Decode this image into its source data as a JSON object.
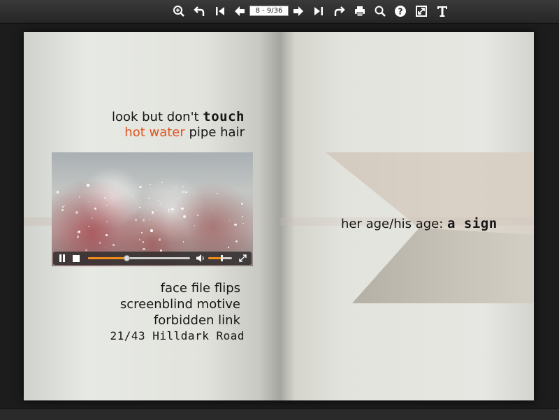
{
  "toolbar": {
    "page_indicator": "8 - 9/36",
    "buttons": [
      {
        "name": "zoom-in-icon"
      },
      {
        "name": "undo-arrow-icon"
      },
      {
        "name": "first-page-icon"
      },
      {
        "name": "previous-page-icon"
      },
      {
        "name": "next-page-icon"
      },
      {
        "name": "last-page-icon"
      },
      {
        "name": "redo-arrow-icon"
      },
      {
        "name": "print-icon"
      },
      {
        "name": "search-icon"
      },
      {
        "name": "help-icon"
      },
      {
        "name": "fullscreen-icon"
      },
      {
        "name": "text-icon"
      }
    ]
  },
  "left_page": {
    "line1_prefix": "look but don't ",
    "line1_hand": "touch",
    "line2_orange": "hot water",
    "line2_rest": " pipe hair",
    "poem": [
      "face file flips",
      "screenblind motive",
      "forbidden link"
    ],
    "address": "21/43 Hilldark Road"
  },
  "video": {
    "progress": 0.38,
    "volume": 0.55
  },
  "right_page": {
    "text_prefix": "her age/his age: ",
    "text_hand": "a sign"
  },
  "colors": {
    "accent": "#e0541f",
    "progress": "#f28c1c",
    "toolbar": "#2e2e2e"
  }
}
